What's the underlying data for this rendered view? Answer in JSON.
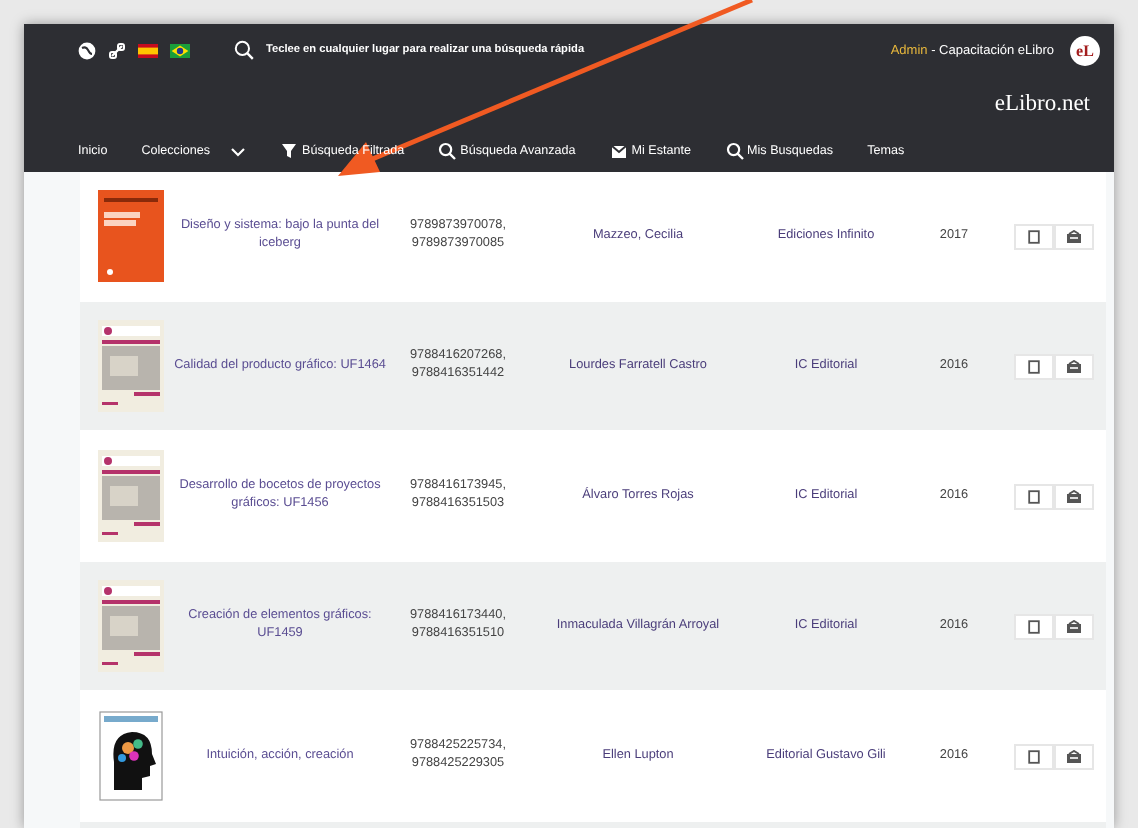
{
  "topbar": {
    "search_placeholder": "Teclee en cualquier lugar para realizar una búsqueda rápida",
    "user": {
      "role": "Admin",
      "separator": " - ",
      "institution": "Capacitación eLibro"
    },
    "logo": "eL"
  },
  "brand": "eLibro.net",
  "nav": [
    {
      "label": "Inicio",
      "kind": "plain"
    },
    {
      "label": "Colecciones",
      "kind": "dropdown"
    },
    {
      "label": "Búsqueda Filtrada",
      "kind": "filter"
    },
    {
      "label": "Búsqueda Avanzada",
      "kind": "search"
    },
    {
      "label": "Mi Estante",
      "kind": "shelf"
    },
    {
      "label": "Mis Busquedas",
      "kind": "search"
    },
    {
      "label": "Temas",
      "kind": "plain"
    }
  ],
  "books": [
    {
      "kind": "solid",
      "title": "Diseño y sistema: bajo la punta del iceberg",
      "isbn": "9789873970078, 9789873970085",
      "author": "Mazzeo, Cecilia",
      "publisher": "Ediciones Infinito",
      "year": "2017"
    },
    {
      "kind": "photo",
      "title": "Calidad del producto gráfico: UF1464",
      "isbn": "9788416207268, 9788416351442",
      "author": "Lourdes Farratell Castro",
      "publisher": "IC Editorial",
      "year": "2016"
    },
    {
      "kind": "photo",
      "title": "Desarrollo de bocetos de proyectos gráficos: UF1456",
      "isbn": "9788416173945, 9788416351503",
      "author": "Álvaro Torres Rojas",
      "publisher": "IC Editorial",
      "year": "2016"
    },
    {
      "kind": "photo",
      "title": "Creación de elementos gráficos: UF1459",
      "isbn": "9788416173440, 9788416351510",
      "author": "Inmaculada Villagrán Arroyal",
      "publisher": "IC Editorial",
      "year": "2016"
    },
    {
      "kind": "poster",
      "title": "Intuición, acción, creación",
      "isbn": "9788425225734, 9788425229305",
      "author": "Ellen Lupton",
      "publisher": "Editorial Gustavo Gili",
      "year": "2016"
    }
  ],
  "annotation": {
    "kind": "arrow"
  }
}
